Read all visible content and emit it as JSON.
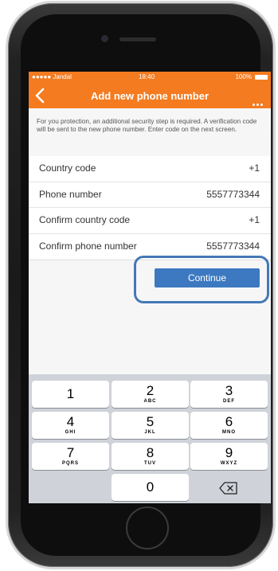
{
  "status_bar": {
    "carrier": "●●●●● Jandal",
    "time": "18:40",
    "battery": "100%"
  },
  "nav": {
    "title": "Add new phone number"
  },
  "notice": "For you protection, an additional security step is required. A verification code will be sent to the new phone number. Enter code on the next screen.",
  "form": {
    "rows": [
      {
        "label": "Country code",
        "value": "+1"
      },
      {
        "label": "Phone number",
        "value": "5557773344"
      },
      {
        "label": "Confirm country code",
        "value": "+1"
      },
      {
        "label": "Confirm phone number",
        "value": "5557773344"
      }
    ]
  },
  "continue_label": "Continue",
  "keypad": {
    "keys": [
      {
        "digit": "1",
        "letters": ""
      },
      {
        "digit": "2",
        "letters": "ABC"
      },
      {
        "digit": "3",
        "letters": "DEF"
      },
      {
        "digit": "4",
        "letters": "GHI"
      },
      {
        "digit": "5",
        "letters": "JKL"
      },
      {
        "digit": "6",
        "letters": "MNO"
      },
      {
        "digit": "7",
        "letters": "PQRS"
      },
      {
        "digit": "8",
        "letters": "TUV"
      },
      {
        "digit": "9",
        "letters": "WXYZ"
      },
      {
        "digit": "0",
        "letters": ""
      }
    ],
    "delete_icon": "backspace-icon"
  },
  "colors": {
    "accent": "#f47b20",
    "button": "#3d79c0",
    "highlight": "#4578b5"
  }
}
